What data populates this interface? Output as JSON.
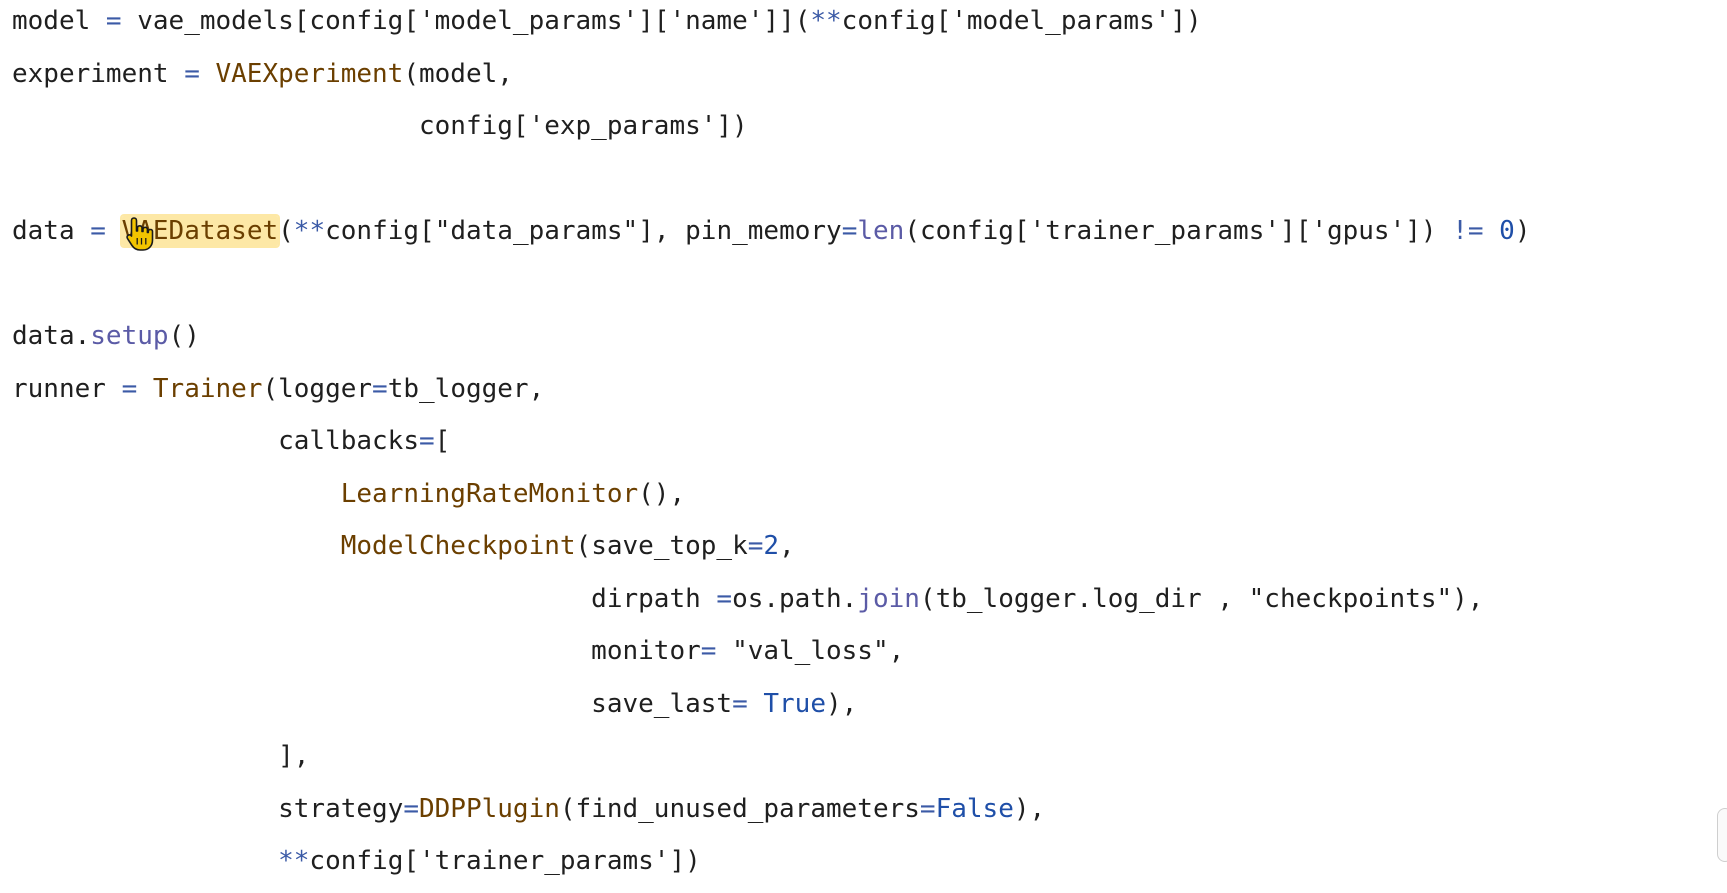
{
  "editor": {
    "lines": [
      [
        {
          "t": "text",
          "v": "model "
        },
        {
          "t": "op",
          "v": "="
        },
        {
          "t": "text",
          "v": " vae_models[config["
        },
        {
          "t": "str",
          "v": "'model_params'"
        },
        {
          "t": "text",
          "v": "]["
        },
        {
          "t": "str",
          "v": "'name'"
        },
        {
          "t": "text",
          "v": "]]("
        },
        {
          "t": "op",
          "v": "**"
        },
        {
          "t": "text",
          "v": "config["
        },
        {
          "t": "str",
          "v": "'model_params'"
        },
        {
          "t": "text",
          "v": "])"
        }
      ],
      [
        {
          "t": "text",
          "v": "experiment "
        },
        {
          "t": "op",
          "v": "="
        },
        {
          "t": "text",
          "v": " "
        },
        {
          "t": "cls",
          "v": "VAEXperiment"
        },
        {
          "t": "text",
          "v": "(model,"
        }
      ],
      [
        {
          "t": "text",
          "v": "                          config["
        },
        {
          "t": "str",
          "v": "'exp_params'"
        },
        {
          "t": "text",
          "v": "])"
        }
      ],
      [],
      [
        {
          "t": "text",
          "v": "data "
        },
        {
          "t": "op",
          "v": "="
        },
        {
          "t": "text",
          "v": " "
        },
        {
          "t": "cls",
          "v": "VAEDataset",
          "hl": true
        },
        {
          "t": "text",
          "v": "("
        },
        {
          "t": "op",
          "v": "**"
        },
        {
          "t": "text",
          "v": "config["
        },
        {
          "t": "str",
          "v": "\"data_params\""
        },
        {
          "t": "text",
          "v": "], pin_memory"
        },
        {
          "t": "op",
          "v": "="
        },
        {
          "t": "fn",
          "v": "len"
        },
        {
          "t": "text",
          "v": "(config["
        },
        {
          "t": "str",
          "v": "'trainer_params'"
        },
        {
          "t": "text",
          "v": "]["
        },
        {
          "t": "str",
          "v": "'gpus'"
        },
        {
          "t": "text",
          "v": "]) "
        },
        {
          "t": "op",
          "v": "!="
        },
        {
          "t": "text",
          "v": " "
        },
        {
          "t": "num",
          "v": "0"
        },
        {
          "t": "text",
          "v": ")"
        }
      ],
      [],
      [
        {
          "t": "text",
          "v": "data."
        },
        {
          "t": "fn",
          "v": "setup"
        },
        {
          "t": "text",
          "v": "()"
        }
      ],
      [
        {
          "t": "text",
          "v": "runner "
        },
        {
          "t": "op",
          "v": "="
        },
        {
          "t": "text",
          "v": " "
        },
        {
          "t": "cls",
          "v": "Trainer"
        },
        {
          "t": "text",
          "v": "(logger"
        },
        {
          "t": "op",
          "v": "="
        },
        {
          "t": "text",
          "v": "tb_logger,"
        }
      ],
      [
        {
          "t": "text",
          "v": "                 callbacks"
        },
        {
          "t": "op",
          "v": "="
        },
        {
          "t": "text",
          "v": "["
        }
      ],
      [
        {
          "t": "text",
          "v": "                     "
        },
        {
          "t": "cls",
          "v": "LearningRateMonitor"
        },
        {
          "t": "text",
          "v": "(),"
        }
      ],
      [
        {
          "t": "text",
          "v": "                     "
        },
        {
          "t": "cls",
          "v": "ModelCheckpoint"
        },
        {
          "t": "text",
          "v": "(save_top_k"
        },
        {
          "t": "op",
          "v": "="
        },
        {
          "t": "num",
          "v": "2"
        },
        {
          "t": "text",
          "v": ","
        }
      ],
      [
        {
          "t": "text",
          "v": "                                     dirpath "
        },
        {
          "t": "op",
          "v": "="
        },
        {
          "t": "text",
          "v": "os.path."
        },
        {
          "t": "fn",
          "v": "join"
        },
        {
          "t": "text",
          "v": "(tb_logger.log_dir , "
        },
        {
          "t": "str",
          "v": "\"checkpoints\""
        },
        {
          "t": "text",
          "v": "),"
        }
      ],
      [
        {
          "t": "text",
          "v": "                                     monitor"
        },
        {
          "t": "op",
          "v": "="
        },
        {
          "t": "text",
          "v": " "
        },
        {
          "t": "str",
          "v": "\"val_loss\""
        },
        {
          "t": "text",
          "v": ","
        }
      ],
      [
        {
          "t": "text",
          "v": "                                     save_last"
        },
        {
          "t": "op",
          "v": "="
        },
        {
          "t": "text",
          "v": " "
        },
        {
          "t": "kw",
          "v": "True"
        },
        {
          "t": "text",
          "v": "),"
        }
      ],
      [
        {
          "t": "text",
          "v": "                 ],"
        }
      ],
      [
        {
          "t": "text",
          "v": "                 strategy"
        },
        {
          "t": "op",
          "v": "="
        },
        {
          "t": "cls",
          "v": "DDPPlugin"
        },
        {
          "t": "text",
          "v": "(find_unused_parameters"
        },
        {
          "t": "op",
          "v": "="
        },
        {
          "t": "kw",
          "v": "False"
        },
        {
          "t": "text",
          "v": "),"
        }
      ],
      [
        {
          "t": "text",
          "v": "                 "
        },
        {
          "t": "op",
          "v": "**"
        },
        {
          "t": "text",
          "v": "config["
        },
        {
          "t": "str",
          "v": "'trainer_params'"
        },
        {
          "t": "text",
          "v": "])"
        }
      ]
    ],
    "colors": {
      "text": "#1f1f1f",
      "operator": "#3b5aa6",
      "class": "#6b3f00",
      "function": "#5b5ba6",
      "number": "#1f4fa8",
      "highlight": "#fde8a6",
      "cursor": "#f2c400"
    },
    "cursor_icon": "hand-pointer-icon"
  }
}
